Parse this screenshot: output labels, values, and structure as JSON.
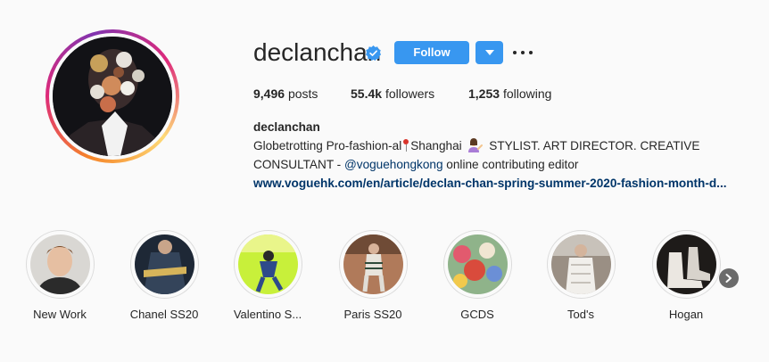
{
  "profile": {
    "username": "declanchan",
    "follow_label": "Follow",
    "stats": [
      {
        "value": "9,496",
        "label": "posts"
      },
      {
        "value": "55.4k",
        "label": "followers"
      },
      {
        "value": "1,253",
        "label": "following"
      }
    ],
    "bio": {
      "name": "declanchan",
      "line1_a": "Globetrotting Pro-fashion-al",
      "line1_b": "Shanghai",
      "line1_c": "STYLIST. ART DIRECTOR. CREATIVE",
      "line2_a": "CONSULTANT - ",
      "line2_mention": "@voguehongkong",
      "line2_b": " online contributing editor",
      "link": "www.voguehk.com/en/article/declan-chan-spring-summer-2020-fashion-month-d..."
    }
  },
  "highlights": [
    {
      "label": "New Work"
    },
    {
      "label": "Chanel SS20"
    },
    {
      "label": "Valentino S..."
    },
    {
      "label": "Paris SS20"
    },
    {
      "label": "GCDS"
    },
    {
      "label": "Tod's"
    },
    {
      "label": "Hogan"
    }
  ],
  "colors": {
    "accent": "#3897f0",
    "link": "#003569",
    "background": "#fafafa"
  },
  "icons": {
    "verified": "verified-badge-icon",
    "dropdown": "chevron-down-icon",
    "more": "more-options-icon",
    "next": "chevron-right-icon"
  }
}
